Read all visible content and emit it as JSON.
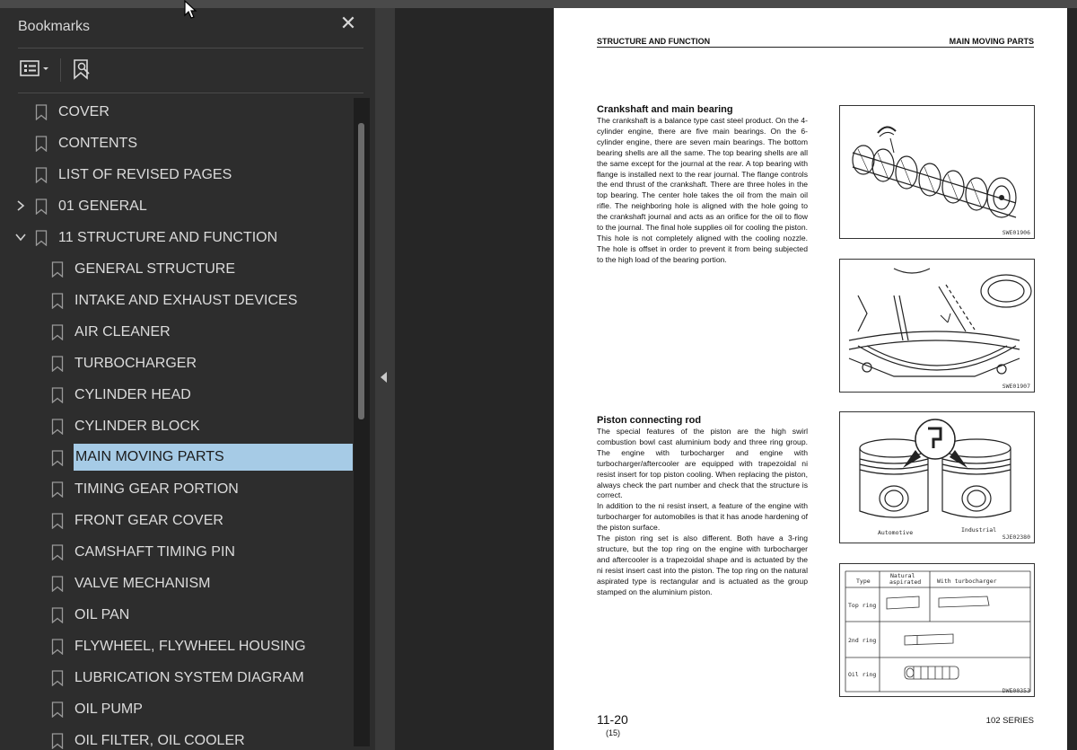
{
  "sidebar": {
    "title": "Bookmarks",
    "close_icon": "close-icon",
    "tools": [
      "options-menu-icon",
      "find-bookmark-icon"
    ],
    "items": [
      {
        "label": "COVER",
        "level": 0,
        "expander": "none",
        "selected": false
      },
      {
        "label": "CONTENTS",
        "level": 0,
        "expander": "none",
        "selected": false
      },
      {
        "label": "LIST OF REVISED PAGES",
        "level": 0,
        "expander": "none",
        "selected": false
      },
      {
        "label": "01 GENERAL",
        "level": 0,
        "expander": "collapsed",
        "selected": false
      },
      {
        "label": "11 STRUCTURE AND FUNCTION",
        "level": 0,
        "expander": "expanded",
        "selected": false
      },
      {
        "label": "GENERAL STRUCTURE",
        "level": 1,
        "expander": "none",
        "selected": false
      },
      {
        "label": "INTAKE AND EXHAUST DEVICES",
        "level": 1,
        "expander": "none",
        "selected": false
      },
      {
        "label": "AIR CLEANER",
        "level": 1,
        "expander": "none",
        "selected": false
      },
      {
        "label": "TURBOCHARGER",
        "level": 1,
        "expander": "none",
        "selected": false
      },
      {
        "label": "CYLINDER HEAD",
        "level": 1,
        "expander": "none",
        "selected": false
      },
      {
        "label": "CYLINDER BLOCK",
        "level": 1,
        "expander": "none",
        "selected": false
      },
      {
        "label": "MAIN MOVING PARTS",
        "level": 1,
        "expander": "none",
        "selected": true
      },
      {
        "label": "TIMING GEAR PORTION",
        "level": 1,
        "expander": "none",
        "selected": false
      },
      {
        "label": "FRONT GEAR COVER",
        "level": 1,
        "expander": "none",
        "selected": false
      },
      {
        "label": "CAMSHAFT TIMING PIN",
        "level": 1,
        "expander": "none",
        "selected": false
      },
      {
        "label": "VALVE MECHANISM",
        "level": 1,
        "expander": "none",
        "selected": false
      },
      {
        "label": "OIL PAN",
        "level": 1,
        "expander": "none",
        "selected": false
      },
      {
        "label": "FLYWHEEL, FLYWHEEL HOUSING",
        "level": 1,
        "expander": "none",
        "selected": false
      },
      {
        "label": "LUBRICATION SYSTEM DIAGRAM",
        "level": 1,
        "expander": "none",
        "selected": false
      },
      {
        "label": "OIL PUMP",
        "level": 1,
        "expander": "none",
        "selected": false
      },
      {
        "label": "OIL FILTER, OIL COOLER",
        "level": 1,
        "expander": "none",
        "selected": false
      }
    ]
  },
  "document": {
    "header_left": "STRUCTURE AND FUNCTION",
    "header_right": "MAIN MOVING PARTS",
    "section1": {
      "title": "Crankshaft and main bearing",
      "body": "The crankshaft is a balance type cast steel product. On the 4-cylinder engine, there are five main bearings. On the 6-cylinder engine, there are seven main bearings. The bottom bearing shells are all the same. The top bearing shells are all the same except for the journal at the rear. A top bearing with flange is installed next to the rear journal. The flange controls the end thrust of the crankshaft. There are three holes in the top bearing. The center hole takes the oil from the main oil rifle. The neighboring hole is aligned with the hole going to the crankshaft journal and acts as an orifice for the oil to flow to the journal. The final hole supplies oil for cooling the piston. This hole is not completely aligned with the cooling nozzle. The hole is offset in order to prevent it from being subjected to the high load of the bearing portion."
    },
    "section2": {
      "title": "Piston connecting rod",
      "body": "The special features of the piston are the high swirl combustion bowl cast aluminium body and three ring group. The engine with turbocharger and engine with turbocharger/aftercooler are equipped with trapezoidal ni resist insert for top piston cooling. When replacing the piston, always check the part number and check that the structure is correct.\nIn addition to the ni resist insert, a feature of the engine with turbocharger for automobiles is that it has anode hardening of the piston surface.\nThe piston ring set is also different. Both have a 3-ring structure, but the top ring on the engine with turbocharger and aftercooler is a trapezoidal shape and is actuated by the ni resist insert cast into the piston. The top ring on the natural aspirated type is rectangular and is actuated as the group stamped on the aluminium piston."
    },
    "figures": {
      "fig1_code": "SWE01906",
      "fig2_code": "SWE01907",
      "fig3_code": "SJE02380",
      "fig3_label_left": "Automotive",
      "fig3_label_right": "Industrial",
      "fig4_code": "DWE00353",
      "fig4_col_type": "Type",
      "fig4_col_natural_1": "Natural",
      "fig4_col_natural_2": "aspirated",
      "fig4_col_turbo": "With turbocharger",
      "fig4_rows": [
        "Top ring",
        "2nd ring",
        "Oil ring"
      ]
    },
    "page_number": "11-20",
    "page_sub": "(15)",
    "series": "102 SERIES"
  },
  "colors": {
    "sidebar_bg": "#2d2d2d",
    "selection": "#a6cbe6",
    "canvas_bg": "#262626",
    "page_bg": "#ffffff"
  }
}
